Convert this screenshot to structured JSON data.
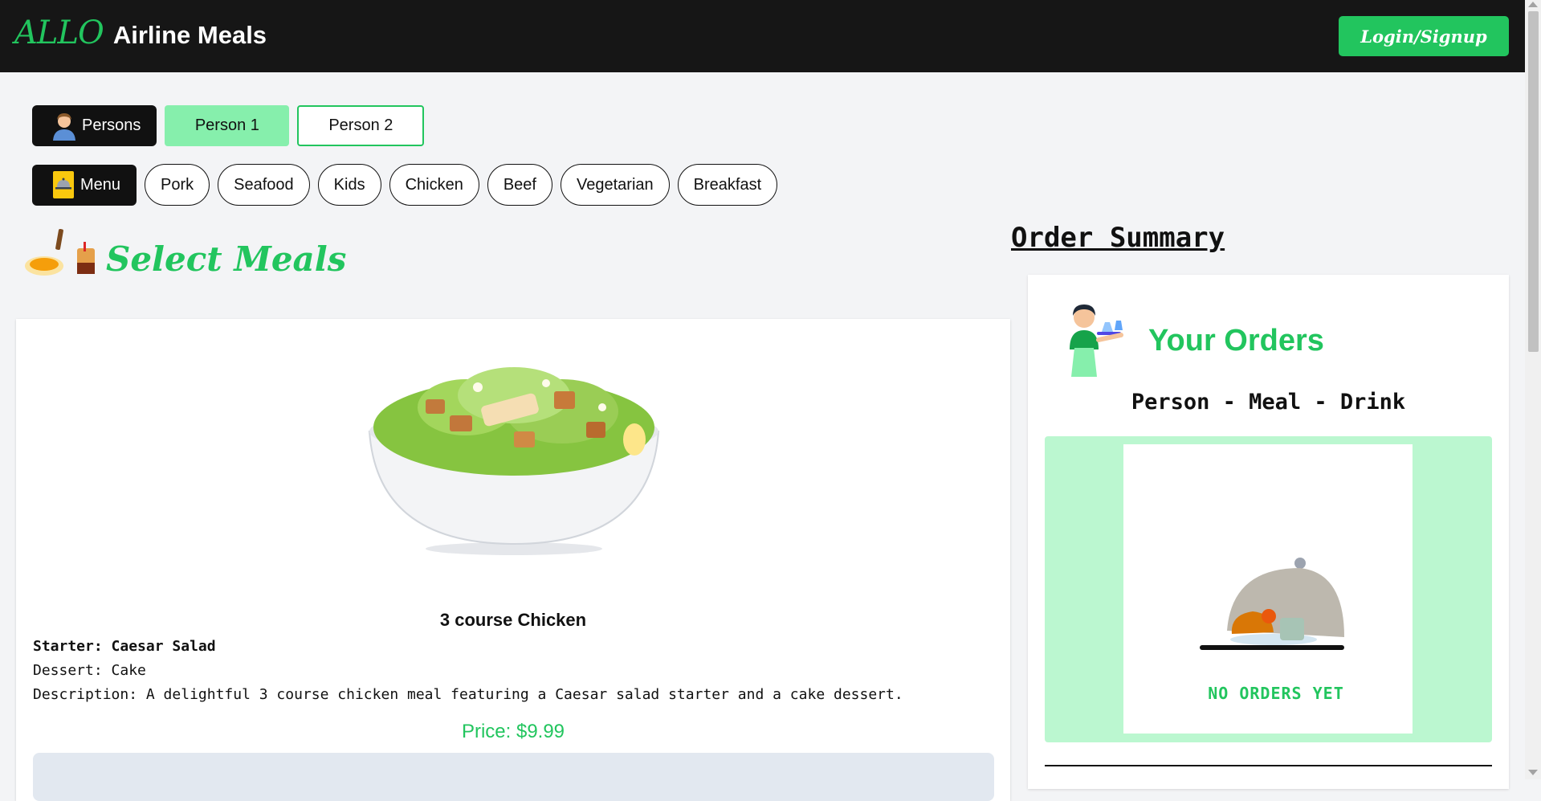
{
  "header": {
    "brand_prefix": "ALLO",
    "brand_name": "Airline Meals",
    "login_label": "Login/Signup"
  },
  "persons": {
    "label": "Persons",
    "icon": "person-avatar-icon",
    "tabs": [
      {
        "label": "Person 1",
        "active": true
      },
      {
        "label": "Person 2",
        "active": false
      }
    ]
  },
  "menu": {
    "label": "Menu",
    "icon": "menu-card-icon",
    "categories": [
      "Pork",
      "Seafood",
      "Kids",
      "Chicken",
      "Beef",
      "Vegetarian",
      "Breakfast"
    ]
  },
  "select_meals": {
    "title": "Select Meals",
    "icon": "meal-tray-icon"
  },
  "meal": {
    "name": "3 course Chicken",
    "starter": "Starter: Caesar Salad",
    "dessert": "Dessert: Cake",
    "description": "Description: A delightful 3 course chicken meal featuring a Caesar salad starter and a cake dessert.",
    "price": "Price: $9.99",
    "image": "caesar-salad-bowl"
  },
  "order_summary": {
    "title": "Order Summary",
    "card_title": "Your Orders",
    "columns": "Person - Meal - Drink",
    "empty_text": "NO ORDERS YET"
  },
  "colors": {
    "accent": "#22c55e",
    "accent_light": "#86efac",
    "panel_green": "#bbf7d0",
    "header_bg": "#161616"
  }
}
